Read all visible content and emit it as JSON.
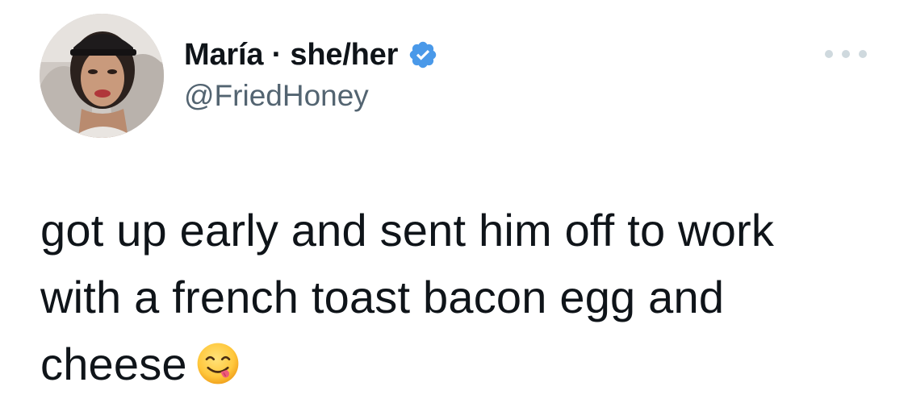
{
  "author": {
    "display_name": "María · she/her",
    "handle": "@FriedHoney",
    "verified": true,
    "verified_color": "#4a99e9"
  },
  "tweet": {
    "text": "got up early and sent him off to work\nwith a french toast bacon egg and\ncheese",
    "emoji": "face-savoring-food-icon"
  },
  "colors": {
    "text": "#0f1419",
    "secondary": "#536471",
    "more_dots": "#cfd9de"
  }
}
